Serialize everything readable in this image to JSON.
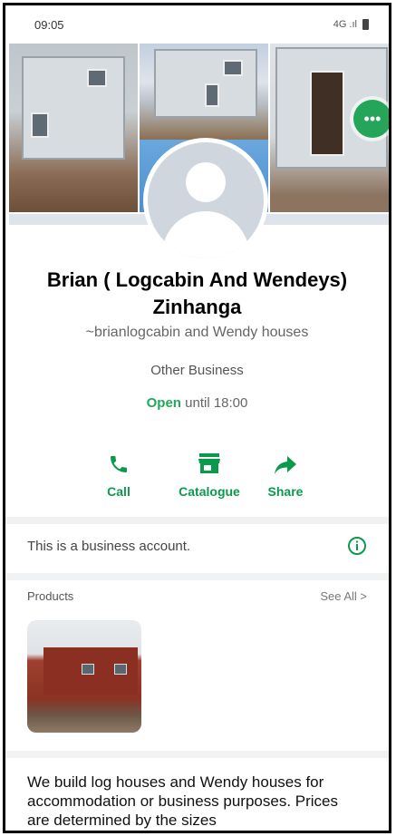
{
  "status_bar": {
    "time": "09:05",
    "signal_text": "4G .ıl"
  },
  "cover": {
    "more_button_label": "•••"
  },
  "profile": {
    "name": "Brian ( Logcabin And Wendeys) Zinhanga",
    "subtitle": "~brianlogcabin and Wendy houses",
    "category": "Other Business",
    "hours_open": "Open",
    "hours_rest": " until 18:00"
  },
  "actions": [
    {
      "label": "Call",
      "icon": "phone-icon"
    },
    {
      "label": "Catalogue",
      "icon": "store-icon"
    },
    {
      "label": "Share",
      "icon": "share-icon"
    }
  ],
  "business_notice": {
    "text": "This is a business account.",
    "icon": "info-icon"
  },
  "products": {
    "title": "Products",
    "see_all": "See All >"
  },
  "description": "We build log houses and Wendy houses for accommodation or business purposes. Prices are determined by the sizes",
  "colors": {
    "accent": "#0b9a4c",
    "open_green": "#1fa855",
    "divider": "#f1f2f3"
  }
}
